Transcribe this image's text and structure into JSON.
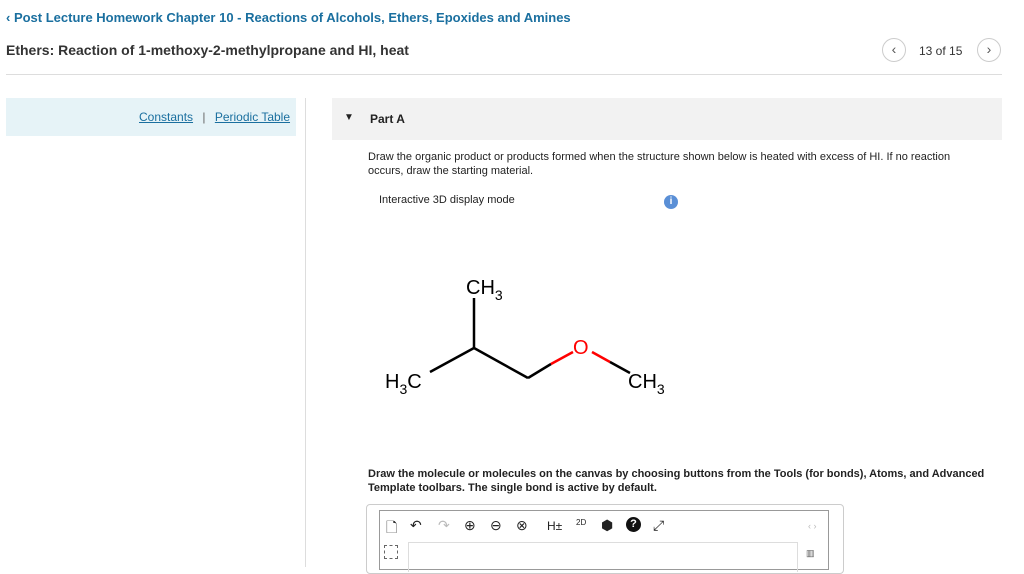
{
  "header": {
    "back_link": "‹ Post Lecture Homework Chapter 10 - Reactions of Alcohols, Ethers, Epoxides and Amines",
    "title": "Ethers: Reaction of 1-methoxy-2-methylpropane and HI, heat",
    "counter": "13 of 15",
    "prev": "‹",
    "next": "›"
  },
  "sidebar": {
    "constants": "Constants",
    "separator": "|",
    "periodic_table": "Periodic Table"
  },
  "part": {
    "label": "Part A",
    "toggle": "▼",
    "question": "Draw the organic product or products formed when the structure shown below is heated with excess of HI. If no reaction occurs, draw the starting material.",
    "display_mode": "Interactive 3D display mode",
    "info": "i",
    "molecule": {
      "ch3_top": "CH",
      "ch3_top_sub": "3",
      "h3c": "H",
      "h3c_sub": "3",
      "h3c_c": "C",
      "oxygen": "O",
      "ch3_right": "CH",
      "ch3_right_sub": "3",
      "oxygen_color": "#ff0000"
    },
    "instructions": "Draw the molecule or molecules on the canvas by choosing buttons from the Tools (for bonds), Atoms, and Advanced Template toolbars. The single bond is active by default."
  },
  "toolbar": {
    "h_toggle": "H±",
    "twod": "2D",
    "arrows": "‹ ›"
  }
}
